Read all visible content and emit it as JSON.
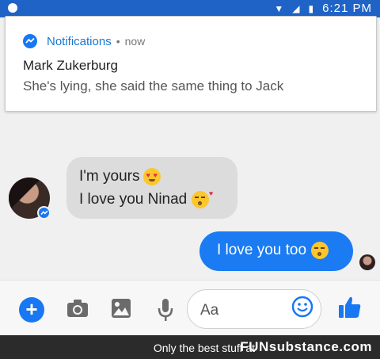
{
  "status_bar": {
    "time": "6:21 PM"
  },
  "notification": {
    "app_name": "Notifications",
    "separator": "•",
    "time": "now",
    "title": "Mark Zukerburg",
    "body": "She's lying, she said the same thing to Jack"
  },
  "chat": {
    "incoming": {
      "line1": "I'm yours",
      "line2": "I love you Ninad"
    },
    "outgoing": {
      "text": "I love you too"
    }
  },
  "composer": {
    "placeholder": "Aa"
  },
  "footer": {
    "tagline": "Only the best stuff at",
    "brand": "FUNsubstance.com"
  },
  "colors": {
    "messenger_blue": "#1a7bf2",
    "status_bar": "#1f63c7"
  },
  "icons": [
    "messenger-icon",
    "add-icon",
    "camera-icon",
    "image-icon",
    "microphone-icon",
    "smiley-icon",
    "thumbs-up-icon",
    "heart-eyes-emoji",
    "kiss-heart-emoji",
    "kissing-emoji"
  ]
}
